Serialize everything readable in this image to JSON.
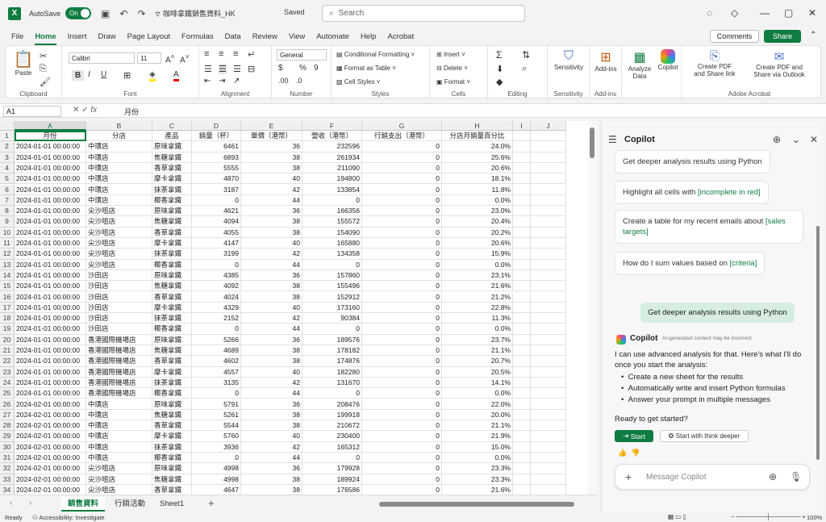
{
  "titlebar": {
    "app_icon": "X",
    "autosave_label": "AutoSave",
    "toggle_label": "On",
    "doc_name": "咖啡拿鐵銷售資料_HK",
    "saved_label": "Saved",
    "search_placeholder": "Search"
  },
  "menu": [
    "File",
    "Home",
    "Insert",
    "Draw",
    "Page Layout",
    "Formulas",
    "Data",
    "Review",
    "View",
    "Automate",
    "Help",
    "Acrobat"
  ],
  "menu_active": "Home",
  "buttons": {
    "comments": "Comments",
    "share": "Share"
  },
  "ribbon": {
    "clipboard": {
      "label": "Clipboard",
      "paste": "Paste"
    },
    "font": {
      "label": "Font",
      "font_name": "Calibri",
      "font_size": "11"
    },
    "alignment": {
      "label": "Alignment"
    },
    "number": {
      "label": "Number",
      "format": "General"
    },
    "styles": {
      "label": "Styles",
      "conditional": "Conditional Formatting",
      "format_table": "Format as Table",
      "cell_styles": "Cell Styles"
    },
    "cells": {
      "label": "Cells",
      "insert": "Insert",
      "delete": "Delete",
      "format": "Format"
    },
    "editing": {
      "label": "Editing"
    },
    "sensitivity": {
      "label": "Sensitivity",
      "btn": "Sensitivity"
    },
    "addins": {
      "label": "Add-ins",
      "btn": "Add-ins"
    },
    "analyze": {
      "btn1": "Analyze",
      "btn2": "Data"
    },
    "copilot_btn": "Copilot",
    "acrobat": {
      "label": "Adobe Acrobat",
      "pdf1a": "Create PDF",
      "pdf1b": "and Share link",
      "pdf2a": "Create PDF and",
      "pdf2b": "Share via Outlook"
    }
  },
  "formula_bar": {
    "cell_ref": "A1",
    "fx": "fx",
    "content": "月份"
  },
  "columns": [
    "A",
    "B",
    "C",
    "D",
    "E",
    "F",
    "G",
    "H",
    "I",
    "J"
  ],
  "headers": [
    "月份",
    "分店",
    "產品",
    "銷量（杯）",
    "單價（港幣）",
    "營收（港幣）",
    "行銷支出（港幣）",
    "分店月銷量百分比"
  ],
  "rows": [
    [
      "2024-01-01 00:00:00",
      "中環店",
      "原味拿鐵",
      "6461",
      "36",
      "232596",
      "0",
      "24.0%"
    ],
    [
      "2024-01-01 00:00:00",
      "中環店",
      "焦糖拿鐵",
      "6893",
      "38",
      "261934",
      "0",
      "25.6%"
    ],
    [
      "2024-01-01 00:00:00",
      "中環店",
      "香草拿鐵",
      "5555",
      "38",
      "211090",
      "0",
      "20.6%"
    ],
    [
      "2024-01-01 00:00:00",
      "中環店",
      "摩卡拿鐵",
      "4870",
      "40",
      "194800",
      "0",
      "18.1%"
    ],
    [
      "2024-01-01 00:00:00",
      "中環店",
      "抹茶拿鐵",
      "3187",
      "42",
      "133854",
      "0",
      "11.8%"
    ],
    [
      "2024-01-01 00:00:00",
      "中環店",
      "椰香拿鐵",
      "0",
      "44",
      "0",
      "0",
      "0.0%"
    ],
    [
      "2024-01-01 00:00:00",
      "尖沙咀店",
      "原味拿鐵",
      "4621",
      "36",
      "166356",
      "0",
      "23.0%"
    ],
    [
      "2024-01-01 00:00:00",
      "尖沙咀店",
      "焦糖拿鐵",
      "4094",
      "38",
      "155572",
      "0",
      "20.4%"
    ],
    [
      "2024-01-01 00:00:00",
      "尖沙咀店",
      "香草拿鐵",
      "4055",
      "38",
      "154090",
      "0",
      "20.2%"
    ],
    [
      "2024-01-01 00:00:00",
      "尖沙咀店",
      "摩卡拿鐵",
      "4147",
      "40",
      "165880",
      "0",
      "20.6%"
    ],
    [
      "2024-01-01 00:00:00",
      "尖沙咀店",
      "抹茶拿鐵",
      "3199",
      "42",
      "134358",
      "0",
      "15.9%"
    ],
    [
      "2024-01-01 00:00:00",
      "尖沙咀店",
      "椰香拿鐵",
      "0",
      "44",
      "0",
      "0",
      "0.0%"
    ],
    [
      "2024-01-01 00:00:00",
      "沙田店",
      "原味拿鐵",
      "4385",
      "36",
      "157860",
      "0",
      "23.1%"
    ],
    [
      "2024-01-01 00:00:00",
      "沙田店",
      "焦糖拿鐵",
      "4092",
      "38",
      "155496",
      "0",
      "21.6%"
    ],
    [
      "2024-01-01 00:00:00",
      "沙田店",
      "香草拿鐵",
      "4024",
      "38",
      "152912",
      "0",
      "21.2%"
    ],
    [
      "2024-01-01 00:00:00",
      "沙田店",
      "摩卡拿鐵",
      "4329",
      "40",
      "173160",
      "0",
      "22.8%"
    ],
    [
      "2024-01-01 00:00:00",
      "沙田店",
      "抹茶拿鐵",
      "2152",
      "42",
      "90384",
      "0",
      "11.3%"
    ],
    [
      "2024-01-01 00:00:00",
      "沙田店",
      "椰香拿鐵",
      "0",
      "44",
      "0",
      "0",
      "0.0%"
    ],
    [
      "2024-01-01 00:00:00",
      "香港國際機場店",
      "原味拿鐵",
      "5266",
      "36",
      "189576",
      "0",
      "23.7%"
    ],
    [
      "2024-01-01 00:00:00",
      "香港國際機場店",
      "焦糖拿鐵",
      "4689",
      "38",
      "178182",
      "0",
      "21.1%"
    ],
    [
      "2024-01-01 00:00:00",
      "香港國際機場店",
      "香草拿鐵",
      "4602",
      "38",
      "174876",
      "0",
      "20.7%"
    ],
    [
      "2024-01-01 00:00:00",
      "香港國際機場店",
      "摩卡拿鐵",
      "4557",
      "40",
      "182280",
      "0",
      "20.5%"
    ],
    [
      "2024-01-01 00:00:00",
      "香港國際機場店",
      "抹茶拿鐵",
      "3135",
      "42",
      "131670",
      "0",
      "14.1%"
    ],
    [
      "2024-01-01 00:00:00",
      "香港國際機場店",
      "椰香拿鐵",
      "0",
      "44",
      "0",
      "0",
      "0.0%"
    ],
    [
      "2024-02-01 00:00:00",
      "中環店",
      "原味拿鐵",
      "5791",
      "36",
      "208476",
      "0",
      "22.0%"
    ],
    [
      "2024-02-01 00:00:00",
      "中環店",
      "焦糖拿鐵",
      "5261",
      "38",
      "199918",
      "0",
      "20.0%"
    ],
    [
      "2024-02-01 00:00:00",
      "中環店",
      "香草拿鐵",
      "5544",
      "38",
      "210672",
      "0",
      "21.1%"
    ],
    [
      "2024-02-01 00:00:00",
      "中環店",
      "摩卡拿鐵",
      "5760",
      "40",
      "230400",
      "0",
      "21.9%"
    ],
    [
      "2024-02-01 00:00:00",
      "中環店",
      "抹茶拿鐵",
      "3936",
      "42",
      "165312",
      "0",
      "15.0%"
    ],
    [
      "2024-02-01 00:00:00",
      "中環店",
      "椰香拿鐵",
      "0",
      "44",
      "0",
      "0",
      "0.0%"
    ],
    [
      "2024-02-01 00:00:00",
      "尖沙咀店",
      "原味拿鐵",
      "4998",
      "36",
      "179928",
      "0",
      "23.3%"
    ],
    [
      "2024-02-01 00:00:00",
      "尖沙咀店",
      "焦糖拿鐵",
      "4998",
      "38",
      "189924",
      "0",
      "23.3%"
    ],
    [
      "2024-02-01 00:00:00",
      "尖沙咀店",
      "香草拿鐵",
      "4647",
      "38",
      "176586",
      "0",
      "21.6%"
    ]
  ],
  "sheets": [
    "銷售資料",
    "行銷活動",
    "Sheet1"
  ],
  "active_sheet": "銷售資料",
  "status": {
    "ready": "Ready",
    "accessibility": "Accessibility: Investigate",
    "zoom": "100%"
  },
  "copilot": {
    "title": "Copilot",
    "suggestions": [
      {
        "text": "Get deeper analysis results using Python",
        "hl": ""
      },
      {
        "text": "Highlight all cells with ",
        "hl": "[incomplete in red]"
      },
      {
        "text": "Create a table for my recent emails about ",
        "hl": "[sales targets]"
      },
      {
        "text": "How do I sum values based on ",
        "hl": "[criteria]"
      }
    ],
    "user_message": "Get deeper analysis results using Python",
    "bot_name": "Copilot",
    "disclaimer": "AI-generated content may be incorrect",
    "reply_intro": "I can use advanced analysis for that. Here's what I'll do once you start the analysis:",
    "bullets": [
      "Create a new sheet for the results",
      "Automatically write and insert Python formulas",
      "Answer your prompt in multiple messages"
    ],
    "ready_q": "Ready to get started?",
    "start_btn": "Start",
    "think_btn": "Start with think deeper",
    "input_placeholder": "Message Copilot"
  }
}
